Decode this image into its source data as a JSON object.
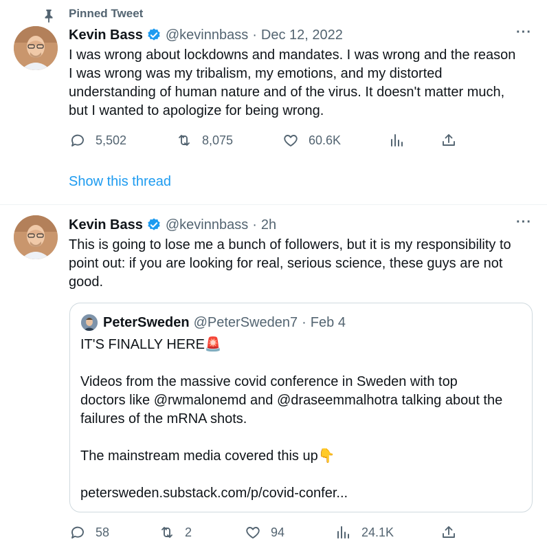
{
  "pinned": {
    "label": "Pinned Tweet"
  },
  "tweet1": {
    "name": "Kevin Bass",
    "handle": "@kevinnbass",
    "sep": "·",
    "date": "Dec 12, 2022",
    "text_lines": [
      "I was wrong about lockdowns and mandates. I was wrong and the reason",
      "I was wrong was my tribalism, my emotions, and my distorted",
      "understanding of human nature and of the virus. It doesn't matter much,",
      "but I wanted to apologize for being wrong."
    ],
    "replies": "5,502",
    "retweets": "8,075",
    "likes": "60.6K",
    "show_thread": "Show this thread"
  },
  "tweet2": {
    "name": "Kevin Bass",
    "handle": "@kevinnbass",
    "sep": "·",
    "date": "2h",
    "text_lines": [
      "This is going to lose me a bunch of followers, but it is my responsibility to",
      "point out: if you are looking for real, serious science, these guys are not",
      "good."
    ],
    "replies": "58",
    "retweets": "2",
    "likes": "94",
    "views": "24.1K"
  },
  "quote": {
    "name": "PeterSweden",
    "handle": "@PeterSweden7",
    "sep": "·",
    "date": "Feb 4",
    "line1": "IT'S FINALLY HERE",
    "line1_emoji": "🚨",
    "line2": "Videos from the massive covid conference in Sweden with top",
    "line3": "doctors like @rwmalonemd and @draseemmalhotra talking about the",
    "line4": "failures of the mRNA shots.",
    "line5": "The mainstream media covered this up",
    "line5_emoji": "👇",
    "link": "petersweden.substack.com/p/covid-confer..."
  },
  "colors": {
    "accent": "#1d9bf0",
    "muted": "#536471",
    "text": "#0f1419",
    "verified": "#1d9bf0"
  },
  "icons": [
    "pin-icon",
    "verified-icon",
    "more-icon",
    "reply-icon",
    "retweet-icon",
    "like-icon",
    "views-icon",
    "share-icon"
  ]
}
